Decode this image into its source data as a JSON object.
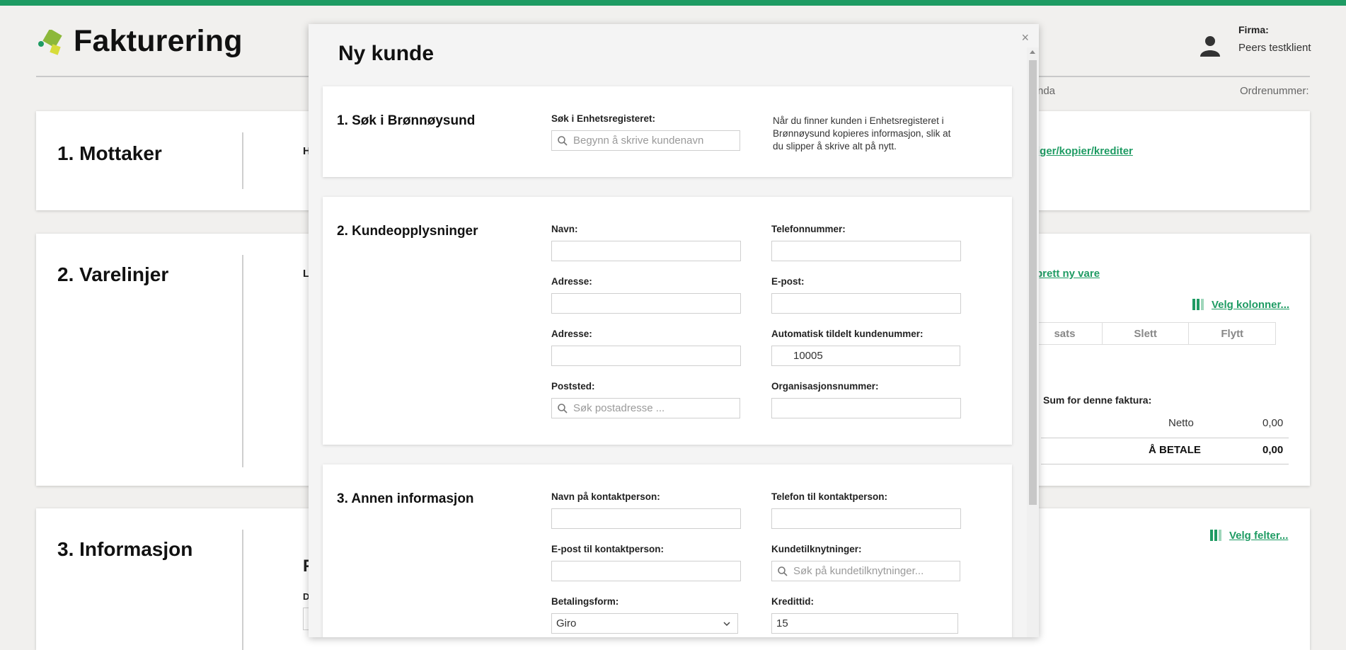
{
  "app": {
    "title": "Fakturering",
    "firma_label": "Firma:",
    "firma_value": "Peers testklient",
    "frag_nda": "nda",
    "frag_ordrenummer": "Ordrenummer:"
  },
  "cards": {
    "mottaker": {
      "title": "1. Mottaker",
      "frag_h": "H",
      "link": "iger/kopier/krediter"
    },
    "varelinjer": {
      "title": "2. Varelinjer",
      "frag_l": "L",
      "link_ny_vare": "prett ny vare",
      "link_kolonner": "Velg kolonner...",
      "columns": [
        "sats",
        "Slett",
        "Flytt"
      ],
      "sum_title": "Sum for denne faktura:",
      "netto_label": "Netto",
      "netto_value": "0,00",
      "betale_label": "Å BETALE",
      "betale_value": "0,00"
    },
    "informasjon": {
      "title": "3. Informasjon",
      "frag_f": "F",
      "frag_d": "D",
      "link_felter": "Velg felter..."
    }
  },
  "modal": {
    "title": "Ny kunde",
    "close": "×",
    "section1": {
      "title": "1. Søk i Brønnøysund",
      "search_label": "Søk i Enhetsregisteret:",
      "search_placeholder": "Begynn å skrive kundenavn",
      "help": "Når du finner kunden i Enhetsregisteret i Brønnøysund kopieres informasjon, slik at du slipper å skrive alt på nytt."
    },
    "section2": {
      "title": "2. Kundeopplysninger",
      "navn_label": "Navn:",
      "telefon_label": "Telefonnummer:",
      "adresse1_label": "Adresse:",
      "epost_label": "E-post:",
      "adresse2_label": "Adresse:",
      "kundenummer_label": "Automatisk tildelt kundenummer:",
      "kundenummer_value": "10005",
      "poststed_label": "Poststed:",
      "poststed_placeholder": "Søk postadresse ...",
      "orgnr_label": "Organisasjonsnummer:"
    },
    "section3": {
      "title": "3. Annen informasjon",
      "kontakt_navn_label": "Navn på kontaktperson:",
      "kontakt_tlf_label": "Telefon til kontaktperson:",
      "kontakt_epost_label": "E-post til kontaktperson:",
      "tilknytning_label": "Kundetilknytninger:",
      "tilknytning_placeholder": "Søk på kundetilknytninger...",
      "betalingsform_label": "Betalingsform:",
      "betalingsform_value": "Giro",
      "kreditt_label": "Kredittid:",
      "kreditt_value": "15"
    }
  },
  "colors": {
    "brand_green": "#1e9b63"
  }
}
